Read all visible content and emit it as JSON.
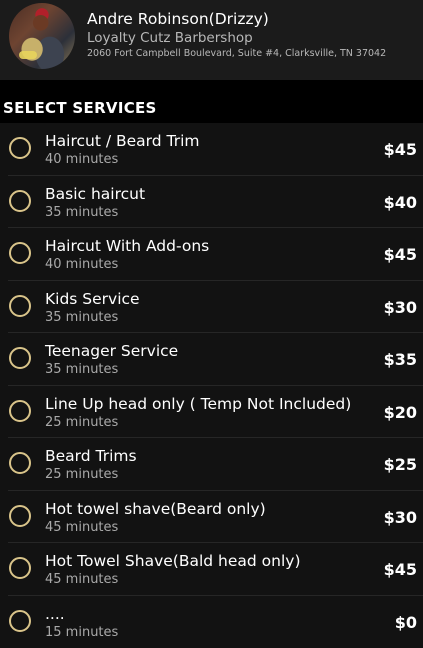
{
  "header": {
    "name": "Andre Robinson(Drizzy)",
    "shop": "Loyalty Cutz Barbershop",
    "address": "2060 Fort Campbell Boulevard, Suite #4, Clarksville, TN 37042"
  },
  "section": {
    "title": "SELECT SERVICES"
  },
  "services": [
    {
      "name": "Haircut / Beard Trim",
      "duration": "40 minutes",
      "price": "$45"
    },
    {
      "name": "Basic haircut",
      "duration": "35 minutes",
      "price": "$40"
    },
    {
      "name": "Haircut With Add-ons",
      "duration": "40 minutes",
      "price": "$45"
    },
    {
      "name": "Kids Service",
      "duration": "35 minutes",
      "price": "$30"
    },
    {
      "name": "Teenager Service",
      "duration": "35 minutes",
      "price": "$35"
    },
    {
      "name": "Line Up head only ( Temp Not Included)",
      "duration": "25 minutes",
      "price": "$20"
    },
    {
      "name": "Beard Trims",
      "duration": "25 minutes",
      "price": "$25"
    },
    {
      "name": "Hot towel shave(Beard only)",
      "duration": "45 minutes",
      "price": "$30"
    },
    {
      "name": "Hot Towel Shave(Bald head only)",
      "duration": "45 minutes",
      "price": "$45"
    },
    {
      "name": "....",
      "duration": "15 minutes",
      "price": "$0"
    }
  ],
  "colors": {
    "accent": "#d9c48a",
    "background": "#000000",
    "row": "#121212"
  }
}
